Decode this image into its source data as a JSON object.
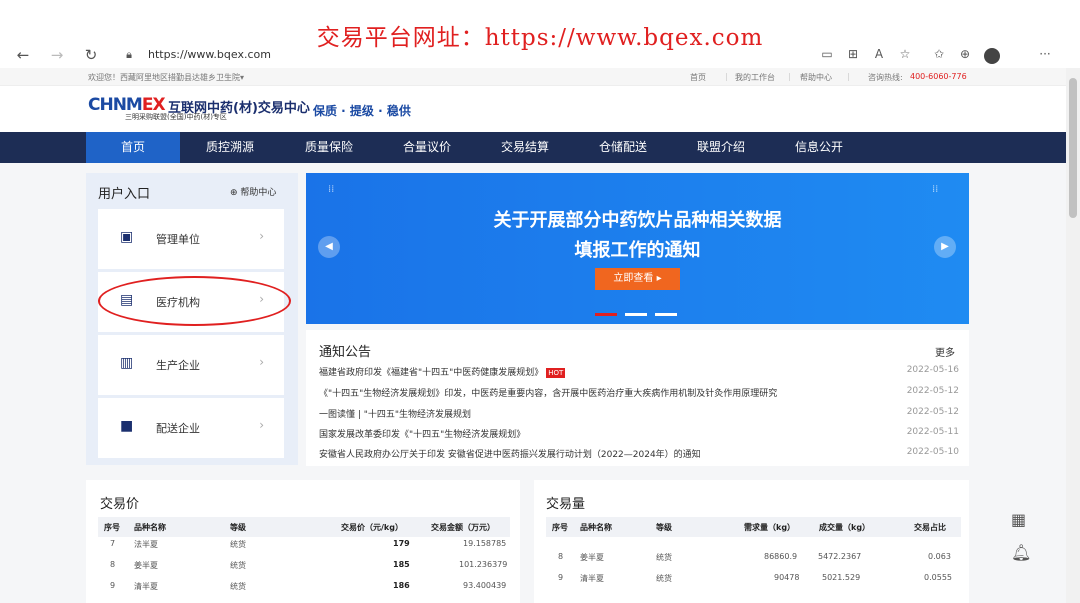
{
  "overlay_title": "交易平台网址：https://www.bqex.com",
  "browser": {
    "url": "https://www.bqex.com",
    "back_icon": "arrow-left-icon",
    "forward_icon": "arrow-right-icon",
    "reload_icon": "reload-icon",
    "menu_label": "···"
  },
  "topstrip": {
    "welcome": "欢迎您！西藏阿里地区措勤县达雄乡卫生院▾",
    "links": [
      "首页",
      "我的工作台",
      "帮助中心"
    ],
    "hotline_label": "咨询热线:",
    "hotline": "400-6060-776"
  },
  "logo": {
    "brand_a": "CHNM",
    "brand_x": "EX",
    "name": "互联网中药(材)交易中心",
    "sub": "三明采购联盟(全国)中药(材)专区",
    "slogan": "保质 · 提级 · 稳供"
  },
  "nav": [
    "首页",
    "质控溯源",
    "质量保险",
    "合量议价",
    "交易结算",
    "仓储配送",
    "联盟介绍",
    "信息公开"
  ],
  "user_panel": {
    "title": "用户入口",
    "help": "⊕ 帮助中心",
    "items": [
      {
        "label": "管理单位",
        "icon": "building-icon"
      },
      {
        "label": "医疗机构",
        "icon": "hospital-icon"
      },
      {
        "label": "生产企业",
        "icon": "factory-icon"
      },
      {
        "label": "配送企业",
        "icon": "truck-icon"
      }
    ]
  },
  "banner": {
    "line1": "关于开展部分中药饮片品种相关数据",
    "line2": "填报工作的通知",
    "button": "立即查看 ▸"
  },
  "notices": {
    "title": "通知公告",
    "more": "更多",
    "hot_badge": "HOT",
    "items": [
      {
        "text": "福建省政府印发《福建省\"十四五\"中医药健康发展规划》",
        "date": "2022-05-16",
        "hot": true
      },
      {
        "text": "《\"十四五\"生物经济发展规划》印发，中医药是重要内容，含开展中医药治疗重大疾病作用机制及针灸作用原理研究",
        "date": "2022-05-12"
      },
      {
        "text": "一图读懂 | \"十四五\"生物经济发展规划",
        "date": "2022-05-12"
      },
      {
        "text": "国家发展改革委印发《\"十四五\"生物经济发展规划》",
        "date": "2022-05-11"
      },
      {
        "text": "安徽省人民政府办公厅关于印发 安徽省促进中医药振兴发展行动计划（2022—2024年）的通知",
        "date": "2022-05-10"
      }
    ]
  },
  "trade_price": {
    "title": "交易价",
    "headers": [
      "序号",
      "品种名称",
      "等级",
      "交易价（元/kg）",
      "交易金额（万元）"
    ],
    "rows": [
      [
        "7",
        "法半夏",
        "统货",
        "179",
        "19.158785"
      ],
      [
        "8",
        "姜半夏",
        "统货",
        "185",
        "101.236379"
      ],
      [
        "9",
        "清半夏",
        "统货",
        "186",
        "93.400439"
      ]
    ]
  },
  "trade_volume": {
    "title": "交易量",
    "headers": [
      "序号",
      "品种名称",
      "等级",
      "需求量（kg）",
      "成交量（kg）",
      "交易占比"
    ],
    "rows": [
      [
        "8",
        "姜半夏",
        "统货",
        "86860.9",
        "5472.2367",
        "0.063"
      ],
      [
        "9",
        "清半夏",
        "统货",
        "90478",
        "5021.529",
        "0.0555"
      ]
    ]
  }
}
